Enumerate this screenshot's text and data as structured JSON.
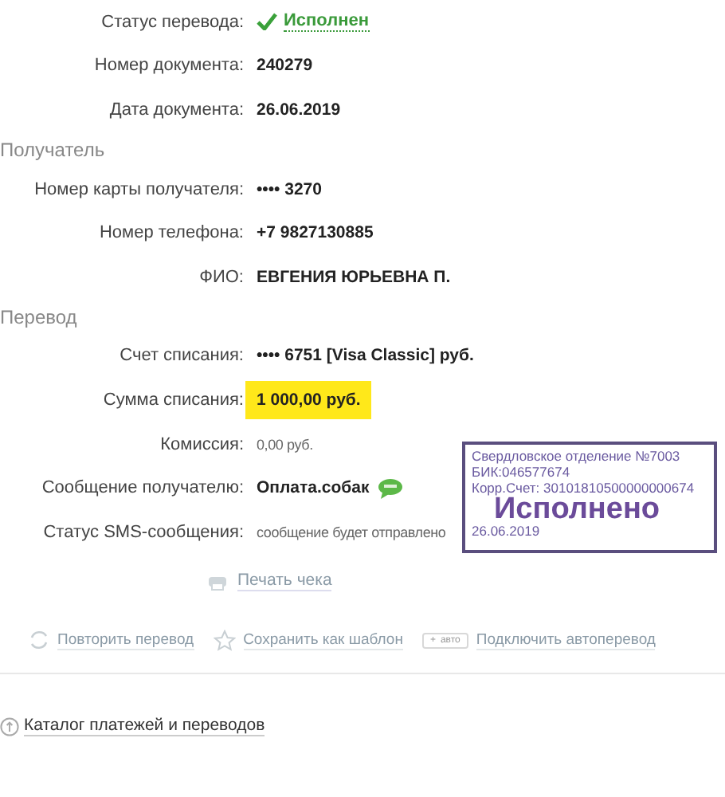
{
  "details": [
    {
      "label": "Статус перевода:",
      "value": "Исполнен",
      "kind": "status"
    },
    {
      "label": "Номер документа:",
      "value": "240279",
      "kind": "bold"
    },
    {
      "label": "Дата документа:",
      "value": "26.06.2019",
      "kind": "bold"
    }
  ],
  "sections": [
    {
      "title": "Получатель",
      "rows": [
        {
          "label": "Номер карты получателя:",
          "value": "•••• 3270",
          "kind": "bold"
        },
        {
          "label": "Номер телефона:",
          "value": "+7 9827130885",
          "kind": "bold"
        },
        {
          "label": "ФИО:",
          "value": "ЕВГЕНИЯ ЮРЬЕВНА П.",
          "kind": "bold"
        }
      ]
    },
    {
      "title": "Перевод",
      "rows": [
        {
          "label": "Счет списания:",
          "value": "•••• 6751  [Visa Classic]  руб.",
          "kind": "bold"
        },
        {
          "label": "Сумма списания:",
          "value": "1 000,00  руб.",
          "kind": "amount"
        },
        {
          "label": "Комиссия:",
          "value": "0,00 руб.",
          "kind": "plain"
        },
        {
          "label": "Сообщение получателю:",
          "value": "Оплата.собак",
          "kind": "message"
        },
        {
          "label": "Статус SMS-сообщения:",
          "value": "сообщение будет отправлено",
          "kind": "plain"
        }
      ]
    }
  ],
  "print_link": "Печать чека",
  "stamp": {
    "lines": [
      "Свердловское отделение №7003",
      "БИК:046577674",
      "Корр.Счет: 30101810500000000674"
    ],
    "mark": "Исполнено",
    "date": "26.06.2019"
  },
  "actions": [
    {
      "label": "Повторить перевод",
      "kind": "repeat"
    },
    {
      "label": "Сохранить как шаблон",
      "kind": "template"
    },
    {
      "label": "Подключить автоперевод",
      "kind": "auto",
      "badge_sign": "+",
      "badge": "авто"
    }
  ],
  "catalog_link": "Каталог платежей и переводов"
}
